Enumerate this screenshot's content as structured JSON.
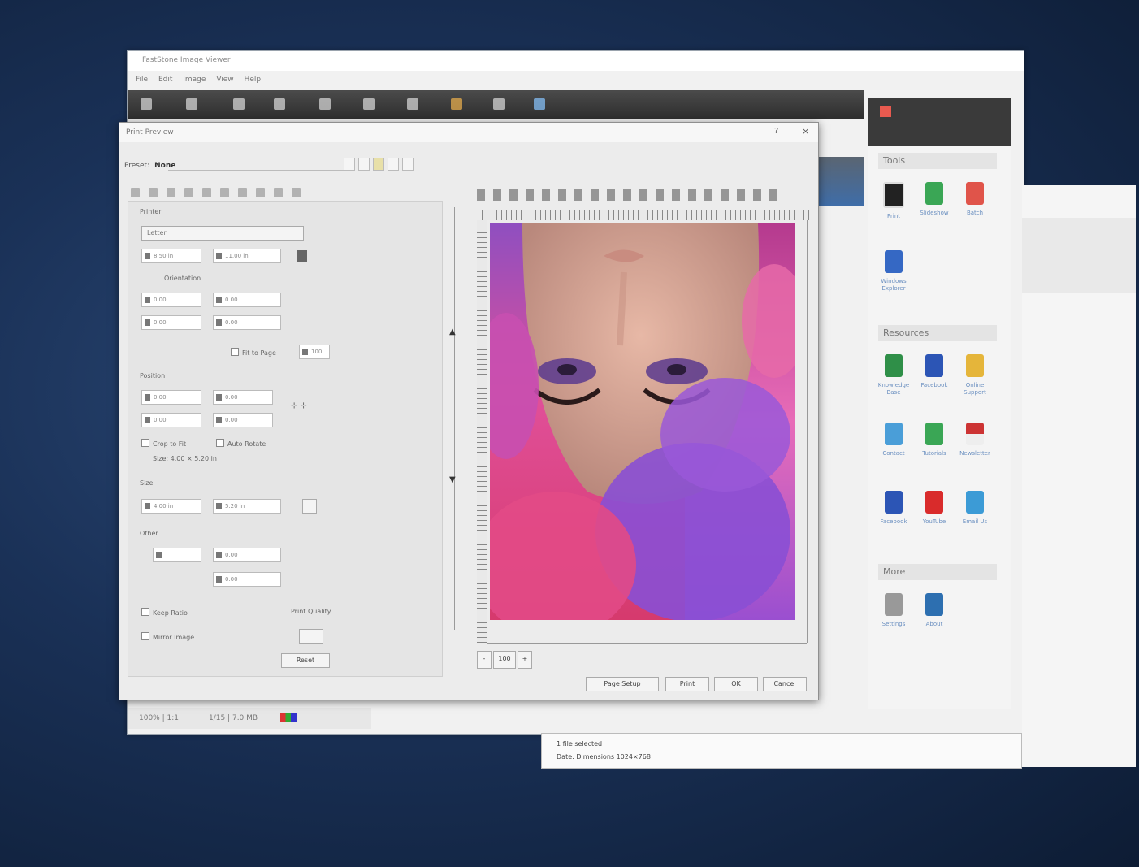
{
  "main_window": {
    "title": "FastStone Image Viewer",
    "menu": [
      "File",
      "Edit",
      "Image",
      "View",
      "Help"
    ],
    "status": [
      "100% | 1:1",
      "1/15 | 7.0 MB"
    ]
  },
  "right_panel": {
    "sections": [
      {
        "title": "Tools",
        "apps": [
          "Print",
          "Slideshow",
          "Batch",
          "Windows Explorer"
        ]
      },
      {
        "title": "Resources",
        "apps": [
          "Knowledge Base",
          "Facebook",
          "Online Support",
          "Contact",
          "Tutorials",
          "Newsletter",
          "Facebook",
          "YouTube",
          "Email Us"
        ]
      },
      {
        "title": "More",
        "apps": [
          "Settings",
          "About"
        ]
      }
    ]
  },
  "small_window": {
    "line1": "1 file selected",
    "line2": "Date:   Dimensions 1024×768"
  },
  "dialog": {
    "title": "Print Preview",
    "help": "?",
    "close": "×",
    "preset_label": "Preset:",
    "preset_value": "None",
    "groups": {
      "printer": "Printer",
      "position": "Position",
      "size": "Size",
      "other": "Other"
    },
    "paper_select": "Letter",
    "fields": {
      "f1": "8.50 in",
      "f2": "11.00 in",
      "f3": "0.00",
      "f4": "0.00",
      "f5": "0.00",
      "f6": "0.00",
      "f7": "0.00",
      "f8": "0.00",
      "f9": "0.00",
      "f10": "0.00",
      "f11": "4.00 in",
      "f12": "5.20 in",
      "f13": "",
      "f14": "0.00",
      "f15": "0.00"
    },
    "orientation_label": "Orientation",
    "scale_label": "Fit to Page",
    "scale_value": "100",
    "keep_ratio": "Keep Ratio",
    "auto_rotate": "Auto Rotate",
    "size_info": "Size:    4.00 × 5.20 in",
    "checks": {
      "crop": "Crop to Fit",
      "mirror": "Mirror Image"
    },
    "bottom_label": "Print Quality",
    "reset_label": "Reset",
    "zoom": [
      "-",
      "100",
      "+"
    ],
    "buttons": [
      "Page Setup",
      "Print",
      "OK",
      "Cancel"
    ]
  }
}
